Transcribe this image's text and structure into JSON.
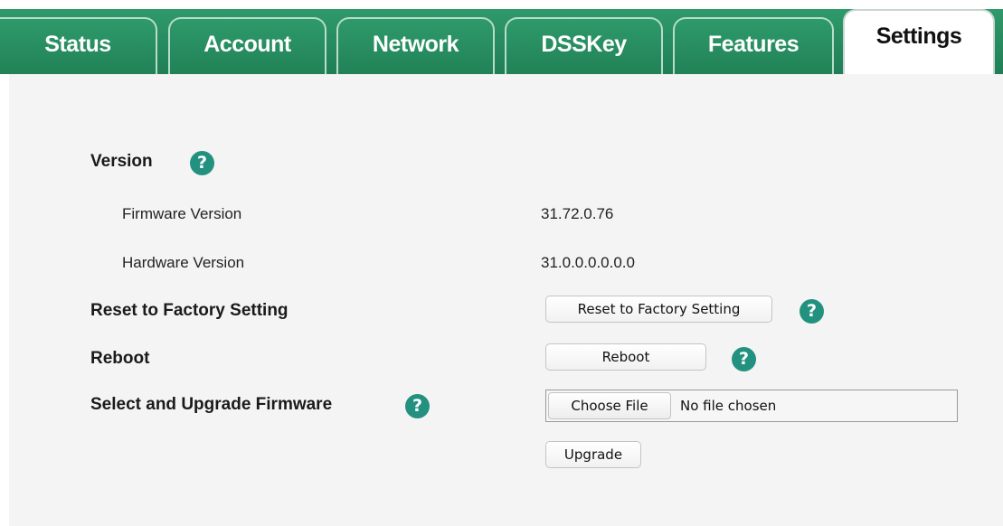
{
  "tabs": [
    {
      "label": "Status",
      "active": false
    },
    {
      "label": "Account",
      "active": false
    },
    {
      "label": "Network",
      "active": false
    },
    {
      "label": "DSSKey",
      "active": false
    },
    {
      "label": "Features",
      "active": false
    },
    {
      "label": "Settings",
      "active": true
    }
  ],
  "colors": {
    "tab_green": "#22875b",
    "help_icon": "#23917f",
    "content_bg": "#f4f4f4"
  },
  "version": {
    "heading": "Version",
    "firmware_label": "Firmware Version",
    "firmware_value": "31.72.0.76",
    "hardware_label": "Hardware Version",
    "hardware_value": "31.0.0.0.0.0.0"
  },
  "reset": {
    "label": "Reset to Factory Setting",
    "button": "Reset to Factory Setting"
  },
  "reboot": {
    "label": "Reboot",
    "button": "Reboot"
  },
  "upgrade": {
    "label": "Select and Upgrade Firmware",
    "choose_button": "Choose File",
    "file_status": "No file chosen",
    "upgrade_button": "Upgrade"
  },
  "help_glyph": "?"
}
